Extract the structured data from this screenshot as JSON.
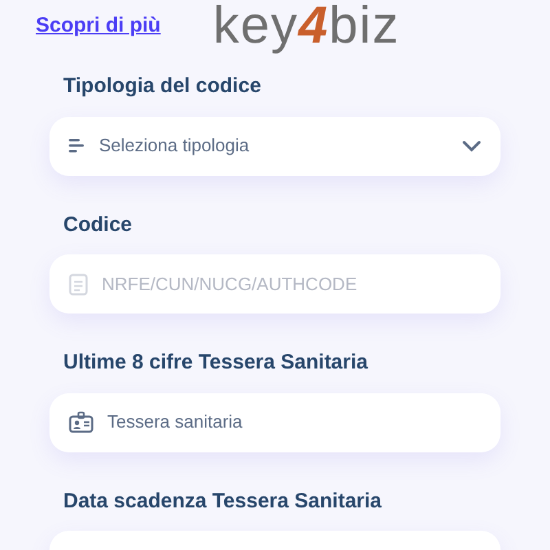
{
  "header": {
    "link": "Scopri di più",
    "logo": {
      "before": "key",
      "accent": "4",
      "after": "biz"
    }
  },
  "fields": [
    {
      "label": "Tipologia del codice",
      "kind": "select",
      "placeholder": "Seleziona tipologia",
      "disabled": false
    },
    {
      "label": "Codice",
      "kind": "document",
      "placeholder": "NRFE/CUN/NUCG/AUTHCODE",
      "disabled": true
    },
    {
      "label": "Ultime 8 cifre Tessera Sanitaria",
      "kind": "card",
      "placeholder": "Tessera sanitaria",
      "disabled": false
    },
    {
      "label": "Data scadenza Tessera Sanitaria",
      "kind": "plain"
    }
  ]
}
